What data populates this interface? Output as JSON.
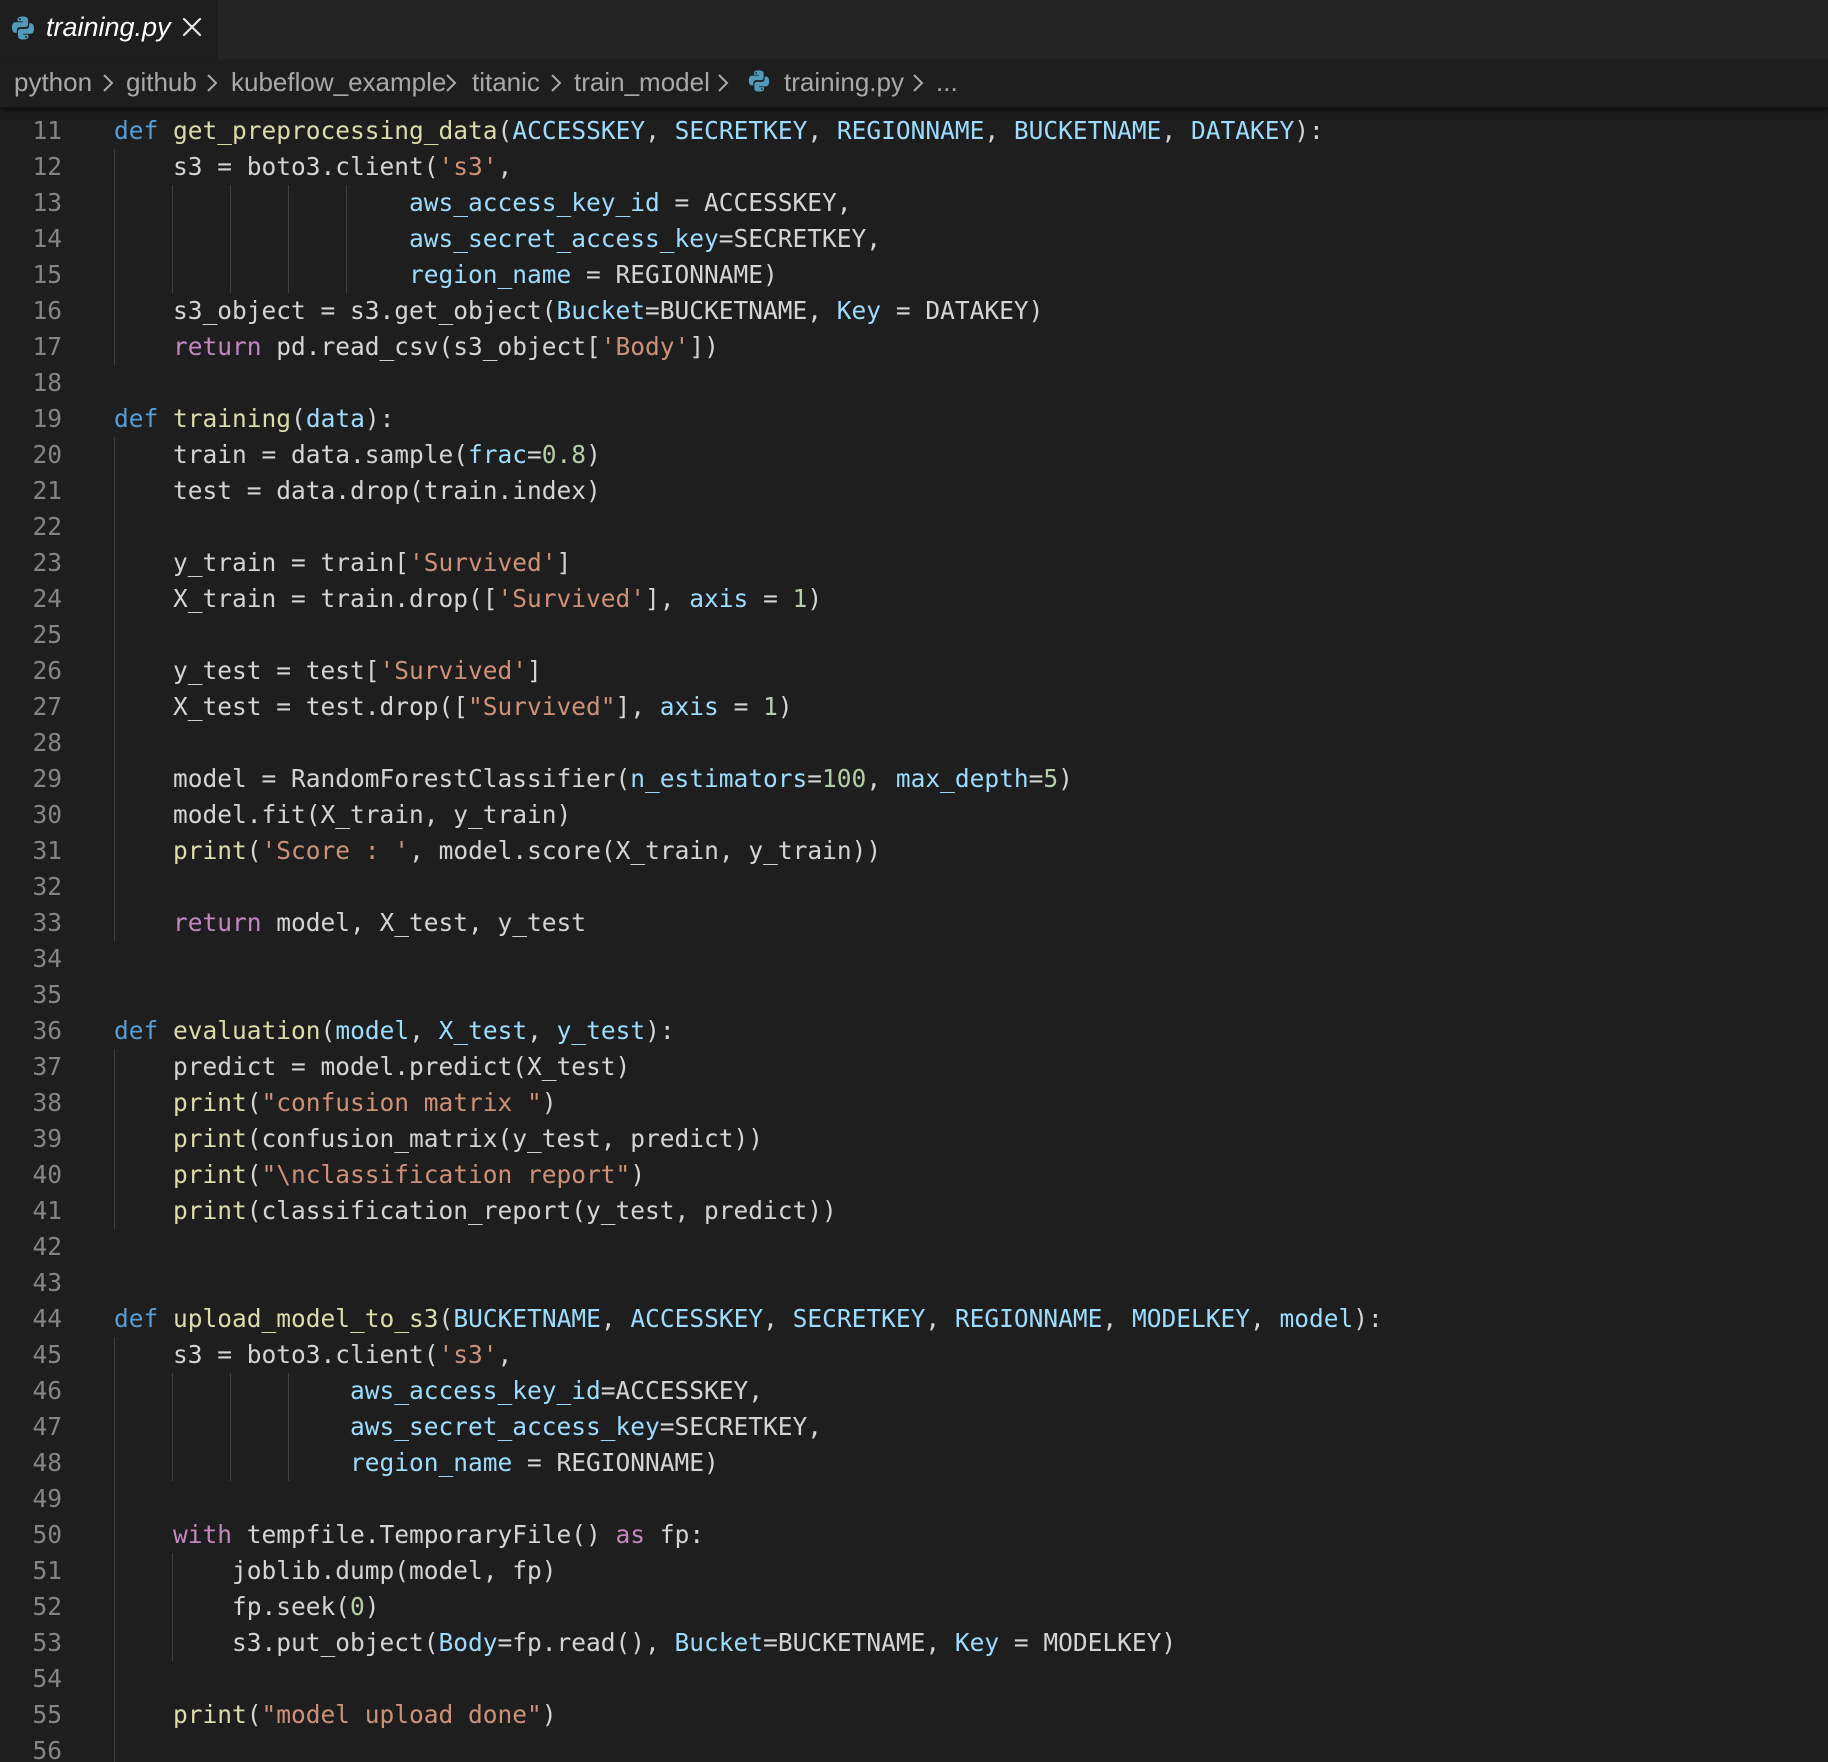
{
  "tab": {
    "label": "training.py",
    "icon": "python-icon",
    "close_icon": "close-icon"
  },
  "breadcrumbs": {
    "items": [
      "python",
      "github",
      "kubeflow_example",
      "titanic",
      "train_model",
      "training.py",
      "..."
    ],
    "file_icon": "python-icon"
  },
  "colors": {
    "background": "#1e1e1e",
    "tabbar": "#252526",
    "keyword": "#569cd6",
    "control": "#c586c0",
    "function": "#dcdcaa",
    "parameter": "#9cdcfe",
    "string": "#ce9178",
    "number": "#b5cea8",
    "text": "#d4d4d4",
    "line_number": "#858585"
  },
  "code": {
    "first_line": 11,
    "lines": [
      [
        [
          "k",
          "def"
        ],
        [
          "t",
          " "
        ],
        [
          "f",
          "get_preprocessing_data"
        ],
        [
          "t",
          "("
        ],
        [
          "p",
          "ACCESSKEY"
        ],
        [
          "t",
          ", "
        ],
        [
          "p",
          "SECRETKEY"
        ],
        [
          "t",
          ", "
        ],
        [
          "p",
          "REGIONNAME"
        ],
        [
          "t",
          ", "
        ],
        [
          "p",
          "BUCKETNAME"
        ],
        [
          "t",
          ", "
        ],
        [
          "p",
          "DATAKEY"
        ],
        [
          "t",
          "):"
        ]
      ],
      [
        [
          "t",
          "    s3 = boto3.client("
        ],
        [
          "s",
          "'s3'"
        ],
        [
          "t",
          ","
        ]
      ],
      [
        [
          "t",
          "                    "
        ],
        [
          "p",
          "aws_access_key_id"
        ],
        [
          "t",
          " = ACCESSKEY,"
        ]
      ],
      [
        [
          "t",
          "                    "
        ],
        [
          "p",
          "aws_secret_access_key"
        ],
        [
          "t",
          "=SECRETKEY,"
        ]
      ],
      [
        [
          "t",
          "                    "
        ],
        [
          "p",
          "region_name"
        ],
        [
          "t",
          " = REGIONNAME)"
        ]
      ],
      [
        [
          "t",
          "    s3_object = s3.get_object("
        ],
        [
          "p",
          "Bucket"
        ],
        [
          "t",
          "=BUCKETNAME, "
        ],
        [
          "p",
          "Key"
        ],
        [
          "t",
          " = DATAKEY)"
        ]
      ],
      [
        [
          "t",
          "    "
        ],
        [
          "c",
          "return"
        ],
        [
          "t",
          " pd.read_csv(s3_object["
        ],
        [
          "s",
          "'Body'"
        ],
        [
          "t",
          "])"
        ]
      ],
      [],
      [
        [
          "k",
          "def"
        ],
        [
          "t",
          " "
        ],
        [
          "f",
          "training"
        ],
        [
          "t",
          "("
        ],
        [
          "p",
          "data"
        ],
        [
          "t",
          "):"
        ]
      ],
      [
        [
          "t",
          "    train = data.sample("
        ],
        [
          "p",
          "frac"
        ],
        [
          "t",
          "="
        ],
        [
          "n",
          "0.8"
        ],
        [
          "t",
          ")"
        ]
      ],
      [
        [
          "t",
          "    test = data.drop(train.index)"
        ]
      ],
      [],
      [
        [
          "t",
          "    y_train = train["
        ],
        [
          "s",
          "'Survived'"
        ],
        [
          "t",
          "]"
        ]
      ],
      [
        [
          "t",
          "    X_train = train.drop(["
        ],
        [
          "s",
          "'Survived'"
        ],
        [
          "t",
          "], "
        ],
        [
          "p",
          "axis"
        ],
        [
          "t",
          " = "
        ],
        [
          "n",
          "1"
        ],
        [
          "t",
          ")"
        ]
      ],
      [],
      [
        [
          "t",
          "    y_test = test["
        ],
        [
          "s",
          "'Survived'"
        ],
        [
          "t",
          "]"
        ]
      ],
      [
        [
          "t",
          "    X_test = test.drop(["
        ],
        [
          "s",
          "\"Survived\""
        ],
        [
          "t",
          "], "
        ],
        [
          "p",
          "axis"
        ],
        [
          "t",
          " = "
        ],
        [
          "n",
          "1"
        ],
        [
          "t",
          ")"
        ]
      ],
      [],
      [
        [
          "t",
          "    model = RandomForestClassifier("
        ],
        [
          "p",
          "n_estimators"
        ],
        [
          "t",
          "="
        ],
        [
          "n",
          "100"
        ],
        [
          "t",
          ", "
        ],
        [
          "p",
          "max_depth"
        ],
        [
          "t",
          "="
        ],
        [
          "n",
          "5"
        ],
        [
          "t",
          ")"
        ]
      ],
      [
        [
          "t",
          "    model.fit(X_train, y_train)"
        ]
      ],
      [
        [
          "t",
          "    "
        ],
        [
          "f",
          "print"
        ],
        [
          "t",
          "("
        ],
        [
          "s",
          "'Score : '"
        ],
        [
          "t",
          ", model.score(X_train, y_train))"
        ]
      ],
      [],
      [
        [
          "t",
          "    "
        ],
        [
          "c",
          "return"
        ],
        [
          "t",
          " model, X_test, y_test"
        ]
      ],
      [],
      [],
      [
        [
          "k",
          "def"
        ],
        [
          "t",
          " "
        ],
        [
          "f",
          "evaluation"
        ],
        [
          "t",
          "("
        ],
        [
          "p",
          "model"
        ],
        [
          "t",
          ", "
        ],
        [
          "p",
          "X_test"
        ],
        [
          "t",
          ", "
        ],
        [
          "p",
          "y_test"
        ],
        [
          "t",
          "):"
        ]
      ],
      [
        [
          "t",
          "    predict = model.predict(X_test)"
        ]
      ],
      [
        [
          "t",
          "    "
        ],
        [
          "f",
          "print"
        ],
        [
          "t",
          "("
        ],
        [
          "s",
          "\"confusion matrix \""
        ],
        [
          "t",
          ")"
        ]
      ],
      [
        [
          "t",
          "    "
        ],
        [
          "f",
          "print"
        ],
        [
          "t",
          "(confusion_matrix(y_test, predict))"
        ]
      ],
      [
        [
          "t",
          "    "
        ],
        [
          "f",
          "print"
        ],
        [
          "t",
          "("
        ],
        [
          "s",
          "\"\\nclassification report\""
        ],
        [
          "t",
          ")"
        ]
      ],
      [
        [
          "t",
          "    "
        ],
        [
          "f",
          "print"
        ],
        [
          "t",
          "(classification_report(y_test, predict))"
        ]
      ],
      [],
      [],
      [
        [
          "k",
          "def"
        ],
        [
          "t",
          " "
        ],
        [
          "f",
          "upload_model_to_s3"
        ],
        [
          "t",
          "("
        ],
        [
          "p",
          "BUCKETNAME"
        ],
        [
          "t",
          ", "
        ],
        [
          "p",
          "ACCESSKEY"
        ],
        [
          "t",
          ", "
        ],
        [
          "p",
          "SECRETKEY"
        ],
        [
          "t",
          ", "
        ],
        [
          "p",
          "REGIONNAME"
        ],
        [
          "t",
          ", "
        ],
        [
          "p",
          "MODELKEY"
        ],
        [
          "t",
          ", "
        ],
        [
          "p",
          "model"
        ],
        [
          "t",
          "):"
        ]
      ],
      [
        [
          "t",
          "    s3 = boto3.client("
        ],
        [
          "s",
          "'s3'"
        ],
        [
          "t",
          ","
        ]
      ],
      [
        [
          "t",
          "                "
        ],
        [
          "p",
          "aws_access_key_id"
        ],
        [
          "t",
          "=ACCESSKEY,"
        ]
      ],
      [
        [
          "t",
          "                "
        ],
        [
          "p",
          "aws_secret_access_key"
        ],
        [
          "t",
          "=SECRETKEY,"
        ]
      ],
      [
        [
          "t",
          "                "
        ],
        [
          "p",
          "region_name"
        ],
        [
          "t",
          " = REGIONNAME)"
        ]
      ],
      [],
      [
        [
          "t",
          "    "
        ],
        [
          "c",
          "with"
        ],
        [
          "t",
          " tempfile.TemporaryFile() "
        ],
        [
          "c",
          "as"
        ],
        [
          "t",
          " fp:"
        ]
      ],
      [
        [
          "t",
          "        joblib.dump(model, fp)"
        ]
      ],
      [
        [
          "t",
          "        fp.seek("
        ],
        [
          "n",
          "0"
        ],
        [
          "t",
          ")"
        ]
      ],
      [
        [
          "t",
          "        s3.put_object("
        ],
        [
          "p",
          "Body"
        ],
        [
          "t",
          "=fp.read(), "
        ],
        [
          "p",
          "Bucket"
        ],
        [
          "t",
          "=BUCKETNAME, "
        ],
        [
          "p",
          "Key"
        ],
        [
          "t",
          " = MODELKEY)"
        ]
      ],
      [],
      [
        [
          "t",
          "    "
        ],
        [
          "f",
          "print"
        ],
        [
          "t",
          "("
        ],
        [
          "s",
          "\"model upload done\""
        ],
        [
          "t",
          ")"
        ]
      ],
      []
    ]
  }
}
